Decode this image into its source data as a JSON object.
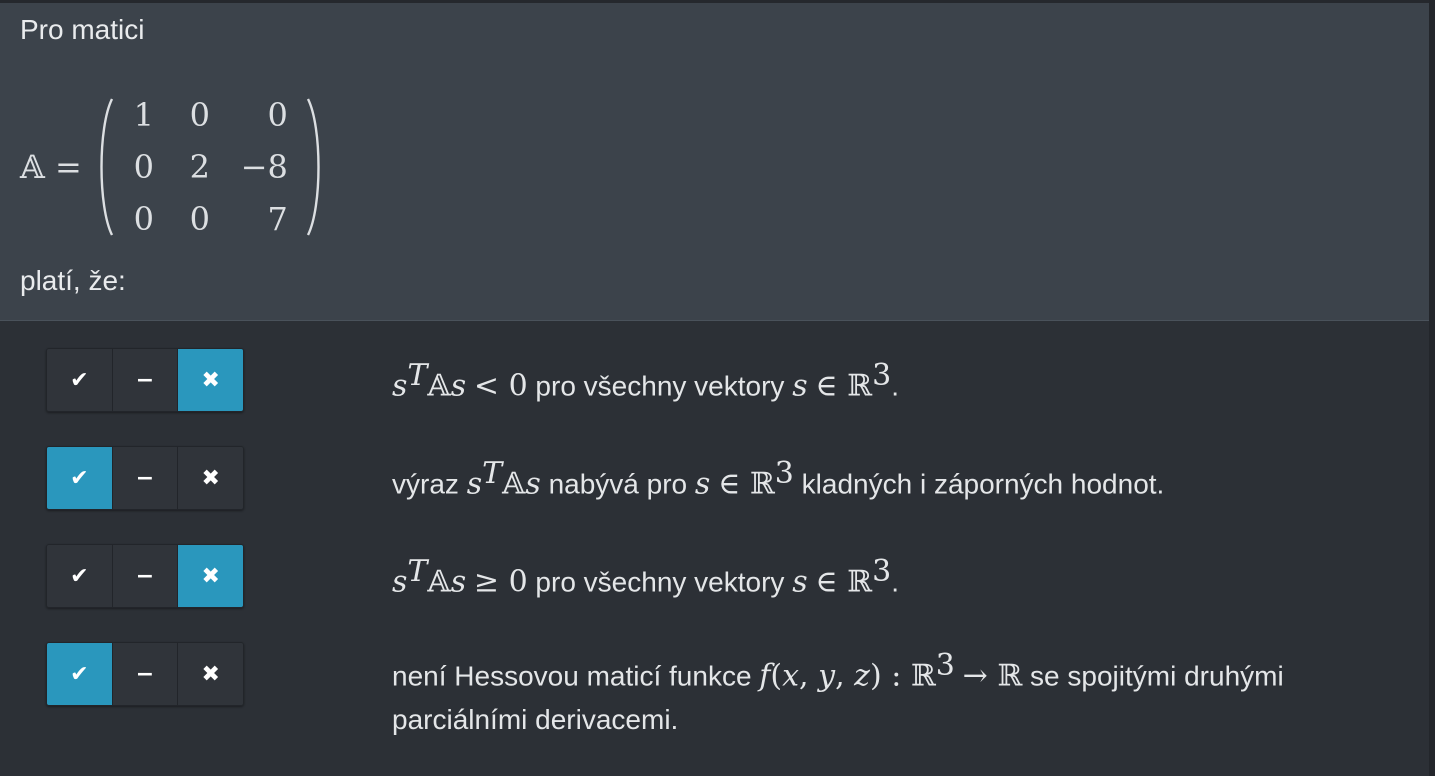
{
  "question": {
    "intro": "Pro matici",
    "matrix_lhs": "𝔸 =",
    "matrix": [
      [
        "1",
        "0",
        "0"
      ],
      [
        "0",
        "2",
        "−8"
      ],
      [
        "0",
        "0",
        "7"
      ]
    ],
    "outro": "platí, že:"
  },
  "toggle_icons": {
    "yes": "✔",
    "neutral": "−",
    "no": "✖"
  },
  "colors": {
    "selected": "#2a97bd",
    "unselected": "#30343a",
    "panel": "#3c434b",
    "background": "#2c3036"
  },
  "answers": [
    {
      "selected": "no",
      "statement_html": "<span class=\"m\">s</span><sup class=\"m\">T</sup><span class=\"mu\">𝔸</span><span class=\"m\">s</span> <span class=\"mu\">&lt; 0</span> pro všechny vektory <span class=\"m\">s</span> <span class=\"mu\">∈ ℝ</span><sup class=\"mu\">3</sup>."
    },
    {
      "selected": "yes",
      "statement_html": "výraz <span class=\"m\">s</span><sup class=\"m\">T</sup><span class=\"mu\">𝔸</span><span class=\"m\">s</span> nabývá pro <span class=\"m\">s</span> <span class=\"mu\">∈ ℝ</span><sup class=\"mu\">3</sup> kladných i záporných hodnot."
    },
    {
      "selected": "no",
      "statement_html": "<span class=\"m\">s</span><sup class=\"m\">T</sup><span class=\"mu\">𝔸</span><span class=\"m\">s</span> <span class=\"mu\">≥ 0</span> pro všechny vektory <span class=\"m\">s</span> <span class=\"mu\">∈ ℝ</span><sup class=\"mu\">3</sup>."
    },
    {
      "selected": "yes",
      "statement_html": "není Hessovou maticí funkce <span class=\"m\">f</span><span class=\"mu\">(</span><span class=\"m\">x</span><span class=\"mu\">, </span><span class=\"m\">y</span><span class=\"mu\">, </span><span class=\"m\">z</span><span class=\"mu\">) : ℝ</span><sup class=\"mu\">3</sup> <span class=\"mu\">→ ℝ</span> se spojitými druhými parciálními derivacemi."
    }
  ]
}
